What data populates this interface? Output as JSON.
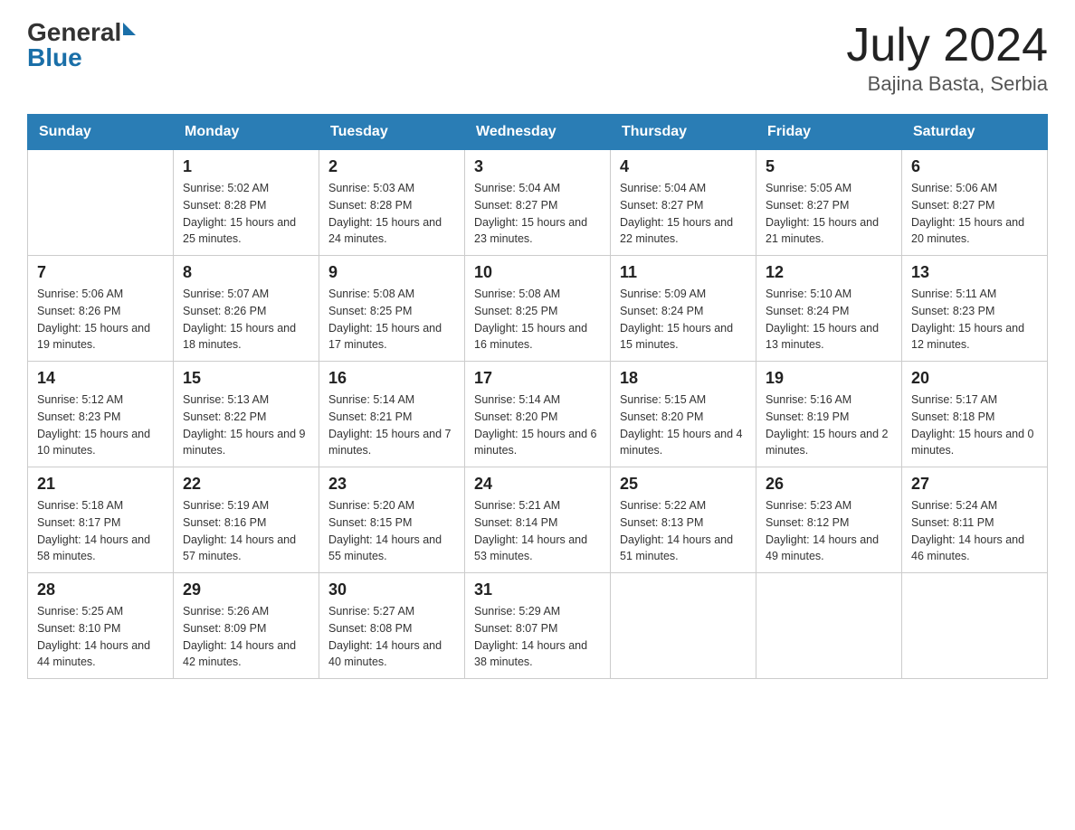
{
  "header": {
    "logo_general": "General",
    "logo_blue": "Blue",
    "title": "July 2024",
    "subtitle": "Bajina Basta, Serbia"
  },
  "days": [
    "Sunday",
    "Monday",
    "Tuesday",
    "Wednesday",
    "Thursday",
    "Friday",
    "Saturday"
  ],
  "weeks": [
    [
      {
        "day": "",
        "sunrise": "",
        "sunset": "",
        "daylight": ""
      },
      {
        "day": "1",
        "sunrise": "Sunrise: 5:02 AM",
        "sunset": "Sunset: 8:28 PM",
        "daylight": "Daylight: 15 hours and 25 minutes."
      },
      {
        "day": "2",
        "sunrise": "Sunrise: 5:03 AM",
        "sunset": "Sunset: 8:28 PM",
        "daylight": "Daylight: 15 hours and 24 minutes."
      },
      {
        "day": "3",
        "sunrise": "Sunrise: 5:04 AM",
        "sunset": "Sunset: 8:27 PM",
        "daylight": "Daylight: 15 hours and 23 minutes."
      },
      {
        "day": "4",
        "sunrise": "Sunrise: 5:04 AM",
        "sunset": "Sunset: 8:27 PM",
        "daylight": "Daylight: 15 hours and 22 minutes."
      },
      {
        "day": "5",
        "sunrise": "Sunrise: 5:05 AM",
        "sunset": "Sunset: 8:27 PM",
        "daylight": "Daylight: 15 hours and 21 minutes."
      },
      {
        "day": "6",
        "sunrise": "Sunrise: 5:06 AM",
        "sunset": "Sunset: 8:27 PM",
        "daylight": "Daylight: 15 hours and 20 minutes."
      }
    ],
    [
      {
        "day": "7",
        "sunrise": "Sunrise: 5:06 AM",
        "sunset": "Sunset: 8:26 PM",
        "daylight": "Daylight: 15 hours and 19 minutes."
      },
      {
        "day": "8",
        "sunrise": "Sunrise: 5:07 AM",
        "sunset": "Sunset: 8:26 PM",
        "daylight": "Daylight: 15 hours and 18 minutes."
      },
      {
        "day": "9",
        "sunrise": "Sunrise: 5:08 AM",
        "sunset": "Sunset: 8:25 PM",
        "daylight": "Daylight: 15 hours and 17 minutes."
      },
      {
        "day": "10",
        "sunrise": "Sunrise: 5:08 AM",
        "sunset": "Sunset: 8:25 PM",
        "daylight": "Daylight: 15 hours and 16 minutes."
      },
      {
        "day": "11",
        "sunrise": "Sunrise: 5:09 AM",
        "sunset": "Sunset: 8:24 PM",
        "daylight": "Daylight: 15 hours and 15 minutes."
      },
      {
        "day": "12",
        "sunrise": "Sunrise: 5:10 AM",
        "sunset": "Sunset: 8:24 PM",
        "daylight": "Daylight: 15 hours and 13 minutes."
      },
      {
        "day": "13",
        "sunrise": "Sunrise: 5:11 AM",
        "sunset": "Sunset: 8:23 PM",
        "daylight": "Daylight: 15 hours and 12 minutes."
      }
    ],
    [
      {
        "day": "14",
        "sunrise": "Sunrise: 5:12 AM",
        "sunset": "Sunset: 8:23 PM",
        "daylight": "Daylight: 15 hours and 10 minutes."
      },
      {
        "day": "15",
        "sunrise": "Sunrise: 5:13 AM",
        "sunset": "Sunset: 8:22 PM",
        "daylight": "Daylight: 15 hours and 9 minutes."
      },
      {
        "day": "16",
        "sunrise": "Sunrise: 5:14 AM",
        "sunset": "Sunset: 8:21 PM",
        "daylight": "Daylight: 15 hours and 7 minutes."
      },
      {
        "day": "17",
        "sunrise": "Sunrise: 5:14 AM",
        "sunset": "Sunset: 8:20 PM",
        "daylight": "Daylight: 15 hours and 6 minutes."
      },
      {
        "day": "18",
        "sunrise": "Sunrise: 5:15 AM",
        "sunset": "Sunset: 8:20 PM",
        "daylight": "Daylight: 15 hours and 4 minutes."
      },
      {
        "day": "19",
        "sunrise": "Sunrise: 5:16 AM",
        "sunset": "Sunset: 8:19 PM",
        "daylight": "Daylight: 15 hours and 2 minutes."
      },
      {
        "day": "20",
        "sunrise": "Sunrise: 5:17 AM",
        "sunset": "Sunset: 8:18 PM",
        "daylight": "Daylight: 15 hours and 0 minutes."
      }
    ],
    [
      {
        "day": "21",
        "sunrise": "Sunrise: 5:18 AM",
        "sunset": "Sunset: 8:17 PM",
        "daylight": "Daylight: 14 hours and 58 minutes."
      },
      {
        "day": "22",
        "sunrise": "Sunrise: 5:19 AM",
        "sunset": "Sunset: 8:16 PM",
        "daylight": "Daylight: 14 hours and 57 minutes."
      },
      {
        "day": "23",
        "sunrise": "Sunrise: 5:20 AM",
        "sunset": "Sunset: 8:15 PM",
        "daylight": "Daylight: 14 hours and 55 minutes."
      },
      {
        "day": "24",
        "sunrise": "Sunrise: 5:21 AM",
        "sunset": "Sunset: 8:14 PM",
        "daylight": "Daylight: 14 hours and 53 minutes."
      },
      {
        "day": "25",
        "sunrise": "Sunrise: 5:22 AM",
        "sunset": "Sunset: 8:13 PM",
        "daylight": "Daylight: 14 hours and 51 minutes."
      },
      {
        "day": "26",
        "sunrise": "Sunrise: 5:23 AM",
        "sunset": "Sunset: 8:12 PM",
        "daylight": "Daylight: 14 hours and 49 minutes."
      },
      {
        "day": "27",
        "sunrise": "Sunrise: 5:24 AM",
        "sunset": "Sunset: 8:11 PM",
        "daylight": "Daylight: 14 hours and 46 minutes."
      }
    ],
    [
      {
        "day": "28",
        "sunrise": "Sunrise: 5:25 AM",
        "sunset": "Sunset: 8:10 PM",
        "daylight": "Daylight: 14 hours and 44 minutes."
      },
      {
        "day": "29",
        "sunrise": "Sunrise: 5:26 AM",
        "sunset": "Sunset: 8:09 PM",
        "daylight": "Daylight: 14 hours and 42 minutes."
      },
      {
        "day": "30",
        "sunrise": "Sunrise: 5:27 AM",
        "sunset": "Sunset: 8:08 PM",
        "daylight": "Daylight: 14 hours and 40 minutes."
      },
      {
        "day": "31",
        "sunrise": "Sunrise: 5:29 AM",
        "sunset": "Sunset: 8:07 PM",
        "daylight": "Daylight: 14 hours and 38 minutes."
      },
      {
        "day": "",
        "sunrise": "",
        "sunset": "",
        "daylight": ""
      },
      {
        "day": "",
        "sunrise": "",
        "sunset": "",
        "daylight": ""
      },
      {
        "day": "",
        "sunrise": "",
        "sunset": "",
        "daylight": ""
      }
    ]
  ]
}
